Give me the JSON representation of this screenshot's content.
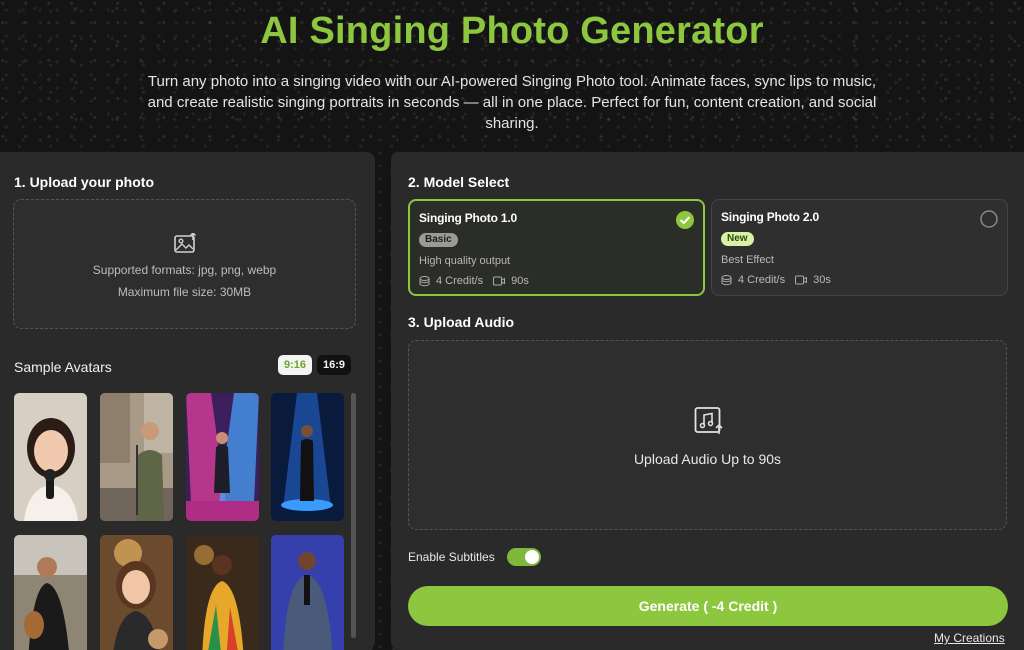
{
  "hero": {
    "title": "AI Singing Photo Generator",
    "description": "Turn any photo into a singing video with our AI-powered Singing Photo tool. Animate faces, sync lips to music, and create realistic singing portraits in seconds — all in one place. Perfect for fun, content creation, and social sharing."
  },
  "upload_photo": {
    "title": "1. Upload your photo",
    "formats": "Supported formats: jpg, png, webp",
    "max_size": "Maximum file size: 30MB",
    "icon": "image-upload-icon"
  },
  "samples": {
    "title": "Sample Avatars",
    "ratios": [
      "9:16",
      "16:9"
    ],
    "selected_ratio": "9:16",
    "avatars": [
      {
        "name": "avatar-woman-microphone"
      },
      {
        "name": "avatar-street-singer"
      },
      {
        "name": "avatar-pink-stage"
      },
      {
        "name": "avatar-blue-stage"
      },
      {
        "name": "avatar-boy-guitar"
      },
      {
        "name": "avatar-girl-teddy"
      },
      {
        "name": "avatar-woman-colorful-dress"
      },
      {
        "name": "avatar-man-purple-stage"
      }
    ]
  },
  "model_select": {
    "title": "2. Model Select",
    "models": [
      {
        "name": "Singing Photo 1.0",
        "badge": "Basic",
        "desc": "High quality output",
        "credits": "4 Credit/s",
        "duration": "90s",
        "selected": true
      },
      {
        "name": "Singing Photo 2.0",
        "badge": "New",
        "desc": "Best Effect",
        "credits": "4 Credit/s",
        "duration": "30s",
        "selected": false
      }
    ]
  },
  "upload_audio": {
    "title": "3. Upload Audio",
    "label": "Upload Audio Up to 90s",
    "icon": "music-upload-icon"
  },
  "subtitles": {
    "label": "Enable Subtitles",
    "enabled": true
  },
  "generate": {
    "label": "Generate ( -4 Credit )"
  },
  "my_creations": "My Creations",
  "colors": {
    "accent": "#8dc63f",
    "panel": "#2a2a2a",
    "background": "#141414"
  }
}
